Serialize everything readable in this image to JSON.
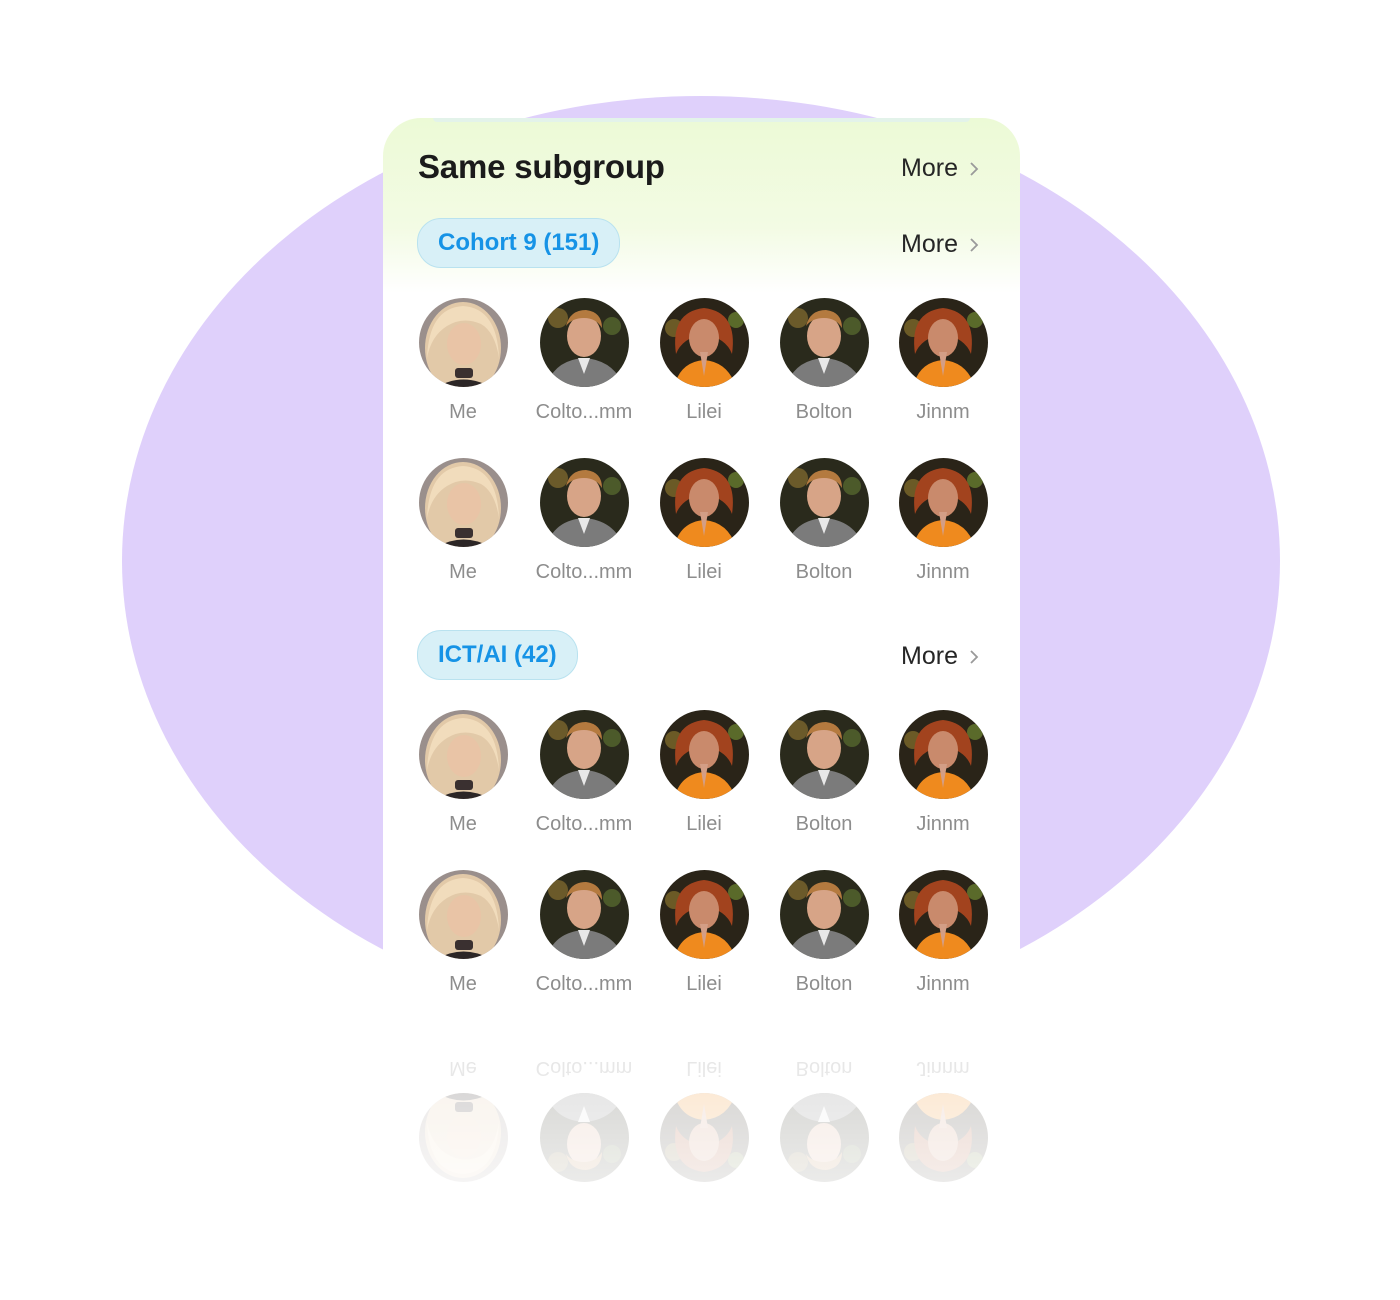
{
  "section": {
    "title": "Same subgroup",
    "more_label": "More"
  },
  "groups": [
    {
      "label": "Cohort 9 (151)",
      "more_label": "More",
      "rows": [
        [
          "Me",
          "Colto...mm",
          "Lilei",
          "Bolton",
          "Jinnm"
        ],
        [
          "Me",
          "Colto...mm",
          "Lilei",
          "Bolton",
          "Jinnm"
        ]
      ]
    },
    {
      "label": "ICT/AI (42)",
      "more_label": "More",
      "rows": [
        [
          "Me",
          "Colto...mm",
          "Lilei",
          "Bolton",
          "Jinnm"
        ],
        [
          "Me",
          "Colto...mm",
          "Lilei",
          "Bolton",
          "Jinnm"
        ]
      ]
    }
  ],
  "reflection": {
    "names": [
      "Me",
      "Colto...mm",
      "Lilei",
      "Bolton",
      "Jinnm"
    ]
  },
  "colors": {
    "background_blob": "#dfd0fb",
    "pill_text": "#1693e6",
    "pill_bg": "#d8f0f7",
    "card_header_gradient": "#ecfad6"
  }
}
